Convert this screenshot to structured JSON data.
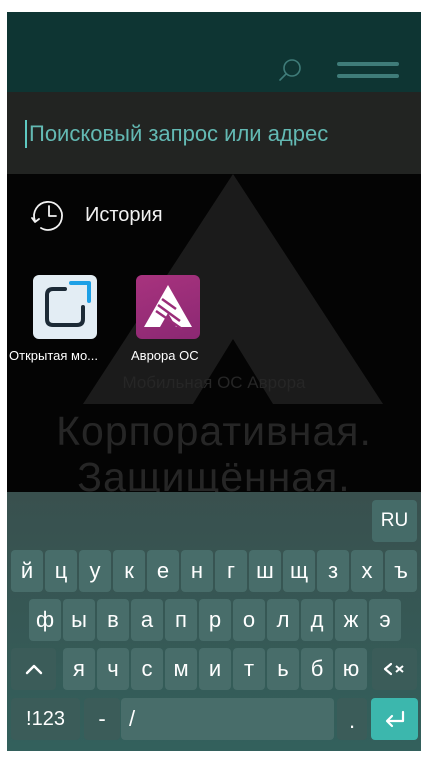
{
  "header": {
    "search_icon": "search-icon",
    "menu_icon": "hamburger-menu-icon"
  },
  "address_bar": {
    "placeholder": "Поисковый запрос или адрес",
    "value": ""
  },
  "history": {
    "icon": "clock-icon",
    "label": "История"
  },
  "tiles": [
    {
      "icon": "open-mobile-platform-logo-icon",
      "label": "Открытая мо..."
    },
    {
      "icon": "aurora-os-logo-icon",
      "label": "Аврора ОС"
    }
  ],
  "background": {
    "caption_small": "Мобильная ОС Аврора",
    "caption_line1": "Корпоративная.",
    "caption_line2": "Защищённая."
  },
  "keyboard": {
    "language": "RU",
    "row1": [
      "й",
      "ц",
      "у",
      "к",
      "е",
      "н",
      "г",
      "ш",
      "щ",
      "з",
      "х",
      "ъ"
    ],
    "row2": [
      "ф",
      "ы",
      "в",
      "а",
      "п",
      "р",
      "о",
      "л",
      "д",
      "ж",
      "э"
    ],
    "row3": [
      "я",
      "ч",
      "с",
      "м",
      "и",
      "т",
      "ь",
      "б",
      "ю"
    ],
    "shift_icon": "shift-caret-icon",
    "backspace_icon": "backspace-icon",
    "symbols_label": "!123",
    "dash_label": "-",
    "slash_label": "/",
    "period_label": ".",
    "enter_icon": "enter-return-icon"
  },
  "colors": {
    "header_bg": "#0e3533",
    "address_bg": "#222422",
    "accent": "#3cb7ad",
    "placeholder": "#63b9b3",
    "key_bg": "#486d6a"
  }
}
